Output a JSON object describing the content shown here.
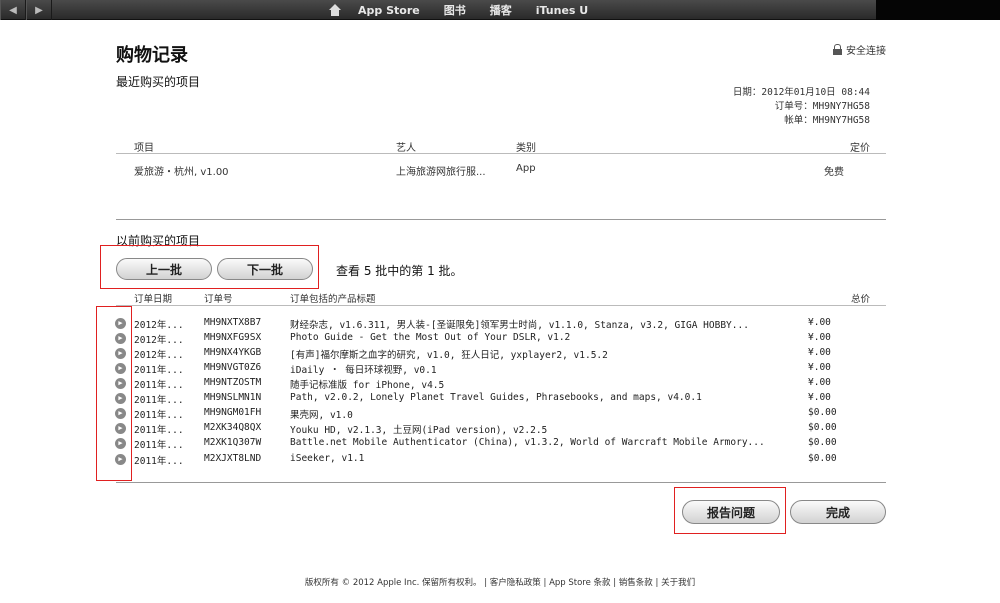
{
  "nav": {
    "back_icon": "◀",
    "forward_icon": "▶",
    "items": [
      "App Store",
      "图书",
      "播客",
      "iTunes U"
    ]
  },
  "header": {
    "title": "购物记录",
    "secure_label": "安全连接"
  },
  "recent": {
    "section_label": "最近购买的项目",
    "date_label": "日期：2012年01月10日 08:44",
    "order_label": "订单号：MH9NY7HG58",
    "invoice_label": "帐单：MH9NY7HG58",
    "columns": {
      "item": "项目",
      "artist": "艺人",
      "category": "类别",
      "price": "定价"
    },
    "row": {
      "item": "爱旅游・杭州, v1.00",
      "artist": "上海旅游网旅行服...",
      "category": "App",
      "price": "免费"
    }
  },
  "history": {
    "section_label": "以前购买的项目",
    "prev_button": "上一批",
    "next_button": "下一批",
    "batch_info": "查看 5 批中的第 1 批。",
    "columns": {
      "date": "订单日期",
      "order": "订单号",
      "titles": "订单包括的产品标题",
      "total": "总价"
    },
    "rows": [
      {
        "date": "2012年...",
        "order": "MH9NXTX8B7",
        "titles": "财经杂志, v1.6.311, 男人装-[圣诞限免]领军男士时尚, v1.1.0, Stanza, v3.2, GIGA HOBBY...",
        "total": "¥.00"
      },
      {
        "date": "2012年...",
        "order": "MH9NXFG9SX",
        "titles": "Photo Guide - Get the Most Out of Your DSLR, v1.2",
        "total": "¥.00"
      },
      {
        "date": "2012年...",
        "order": "MH9NX4YKGB",
        "titles": "[有声]福尔摩斯之血字的研究, v1.0, 狂人日记, yxplayer2, v1.5.2",
        "total": "¥.00"
      },
      {
        "date": "2011年...",
        "order": "MH9NVGT0Z6",
        "titles": "iDaily ・ 每日环球视野, v0.1",
        "total": "¥.00"
      },
      {
        "date": "2011年...",
        "order": "MH9NTZOSTM",
        "titles": "随手记标准版 for iPhone, v4.5",
        "total": "¥.00"
      },
      {
        "date": "2011年...",
        "order": "MH9NSLMN1N",
        "titles": "Path, v2.0.2, Lonely Planet Travel Guides, Phrasebooks, and maps, v4.0.1",
        "total": "¥.00"
      },
      {
        "date": "2011年...",
        "order": "MH9NGM01FH",
        "titles": "果壳网, v1.0",
        "total": "$0.00"
      },
      {
        "date": "2011年...",
        "order": "M2XK34Q8QX",
        "titles": "Youku HD, v2.1.3, 土豆网(iPad version), v2.2.5",
        "total": "$0.00"
      },
      {
        "date": "2011年...",
        "order": "M2XK1Q307W",
        "titles": "Battle.net Mobile Authenticator (China), v1.3.2, World of Warcraft Mobile Armory...",
        "total": "$0.00"
      },
      {
        "date": "2011年...",
        "order": "M2XJXT8LND",
        "titles": "iSeeker, v1.1",
        "total": "$0.00"
      }
    ]
  },
  "actions": {
    "report_button": "报告问题",
    "done_button": "完成"
  },
  "footer": {
    "text": "版权所有 © 2012 Apple Inc. 保留所有权利。 | 客户隐私政策 | App Store 条款 | 销售条款 | 关于我们"
  }
}
